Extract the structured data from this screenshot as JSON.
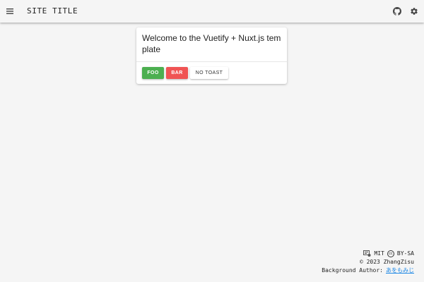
{
  "app_bar": {
    "title": "SITE TITLE",
    "menu_icon": "menu-icon",
    "github_icon": "github-icon",
    "settings_icon": "gear-icon"
  },
  "card": {
    "title": "Welcome to the Vuetify + Nuxt.js template",
    "buttons": {
      "foo": "FOO",
      "bar": "BAR",
      "no_toast": "NO TOAST"
    }
  },
  "footer": {
    "license": "MIT",
    "cc_badge": "cc",
    "cc_license": "BY-SA",
    "copyright": "© 2023 ZhangZisu",
    "background_author_label": "Background Author:",
    "background_author_name": "あをもみじ"
  },
  "colors": {
    "foo_button": "#4caf50",
    "bar_button": "#f05454",
    "link": "#1e88e5"
  }
}
